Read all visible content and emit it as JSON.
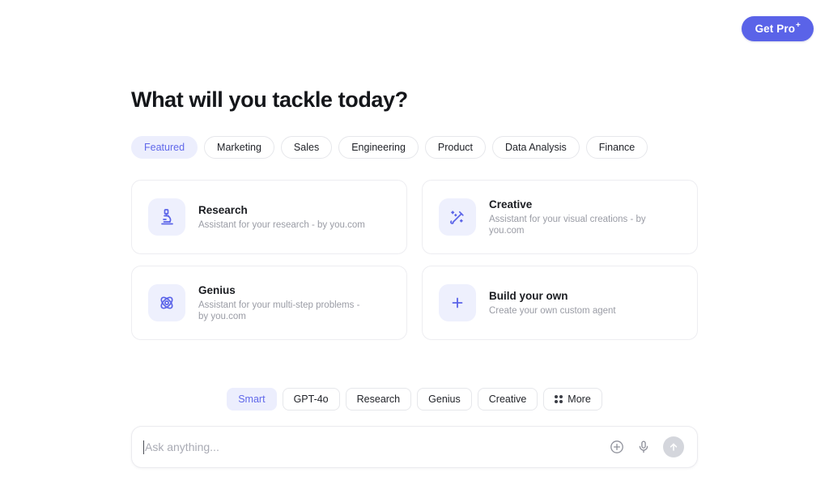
{
  "topbar": {
    "get_pro_label": "Get Pro",
    "get_pro_superscript": "+"
  },
  "main": {
    "headline": "What will you tackle today?",
    "categories": [
      {
        "label": "Featured",
        "active": true
      },
      {
        "label": "Marketing",
        "active": false
      },
      {
        "label": "Sales",
        "active": false
      },
      {
        "label": "Engineering",
        "active": false
      },
      {
        "label": "Product",
        "active": false
      },
      {
        "label": "Data Analysis",
        "active": false
      },
      {
        "label": "Finance",
        "active": false
      }
    ],
    "cards": [
      {
        "title": "Research",
        "description": "Assistant for your research - by you.com",
        "icon": "microscope-icon"
      },
      {
        "title": "Creative",
        "description": "Assistant for your visual creations - by you.com",
        "icon": "magic-wand-icon"
      },
      {
        "title": "Genius",
        "description": "Assistant for your multi-step problems - by you.com",
        "icon": "atom-icon"
      },
      {
        "title": "Build your own",
        "description": "Create your own custom agent",
        "icon": "plus-icon"
      }
    ]
  },
  "models": [
    {
      "label": "Smart",
      "active": true
    },
    {
      "label": "GPT-4o",
      "active": false
    },
    {
      "label": "Research",
      "active": false
    },
    {
      "label": "Genius",
      "active": false
    },
    {
      "label": "Creative",
      "active": false
    },
    {
      "label": "More",
      "active": false,
      "icon": "grid-dots-icon"
    }
  ],
  "composer": {
    "placeholder": "Ask anything...",
    "value": "",
    "attach_icon": "plus-circle-icon",
    "mic_icon": "microphone-icon",
    "send_icon": "arrow-up-icon"
  },
  "colors": {
    "accent": "#6068ea",
    "accent_soft": "#eceefd",
    "brand_button": "#5a63e8",
    "text_primary": "#1b1d22",
    "text_muted": "#9a9ca5",
    "border": "#e6e7eb",
    "send_disabled": "#d4d6dc"
  }
}
